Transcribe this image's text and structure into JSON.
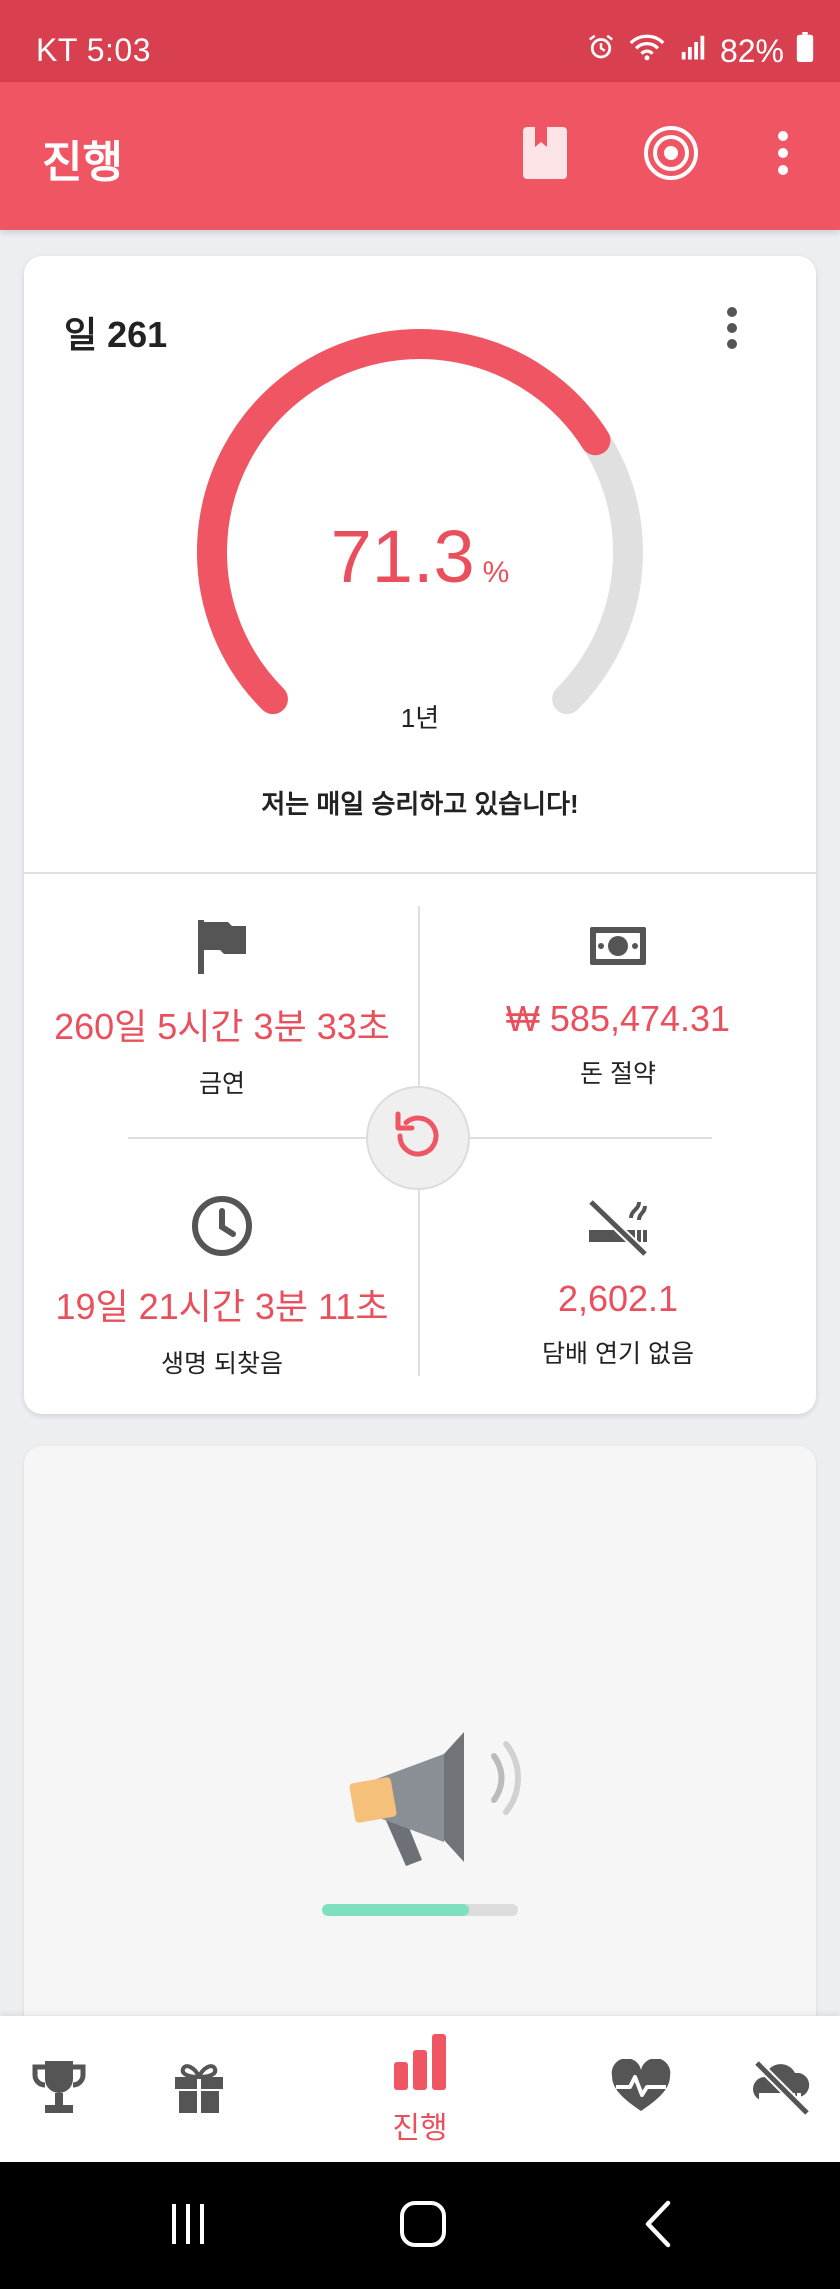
{
  "status_bar": {
    "carrier_time": "KT  5:03",
    "battery": "82%"
  },
  "app_bar": {
    "title": "진행",
    "icons": [
      "bookmark-icon",
      "target-icon",
      "more-vert-icon"
    ]
  },
  "progress_card": {
    "day_label": "일 261",
    "percent_value": "71.3",
    "percent_unit": "%",
    "percent_fraction": 0.713,
    "goal_label": "1년",
    "motto": "저는 매일 승리하고 있습니다!",
    "accent_color": "#f05563",
    "track_color": "#e0e0e0"
  },
  "stats": [
    {
      "icon": "flag-icon",
      "value": "260일 5시간 3분 33초",
      "label": "금연"
    },
    {
      "icon": "money-icon",
      "value": "₩ 585,474.31",
      "label": "돈 절약"
    },
    {
      "icon": "clock-icon",
      "value": "19일 21시간 3분 11초",
      "label": "생명 되찾음"
    },
    {
      "icon": "no-smoking-icon",
      "value": "2,602.1",
      "label": "담배 연기 없음"
    }
  ],
  "ad_card": {
    "icon": "megaphone-icon",
    "loading_fraction": 0.75
  },
  "bottom_nav": {
    "items": [
      "trophy-icon",
      "gift-icon",
      "progress-chart-icon",
      "health-icon",
      "no-smoking-cloud-icon"
    ],
    "active_label": "진행"
  },
  "system_nav": [
    "recents-icon",
    "home-icon",
    "back-icon"
  ]
}
